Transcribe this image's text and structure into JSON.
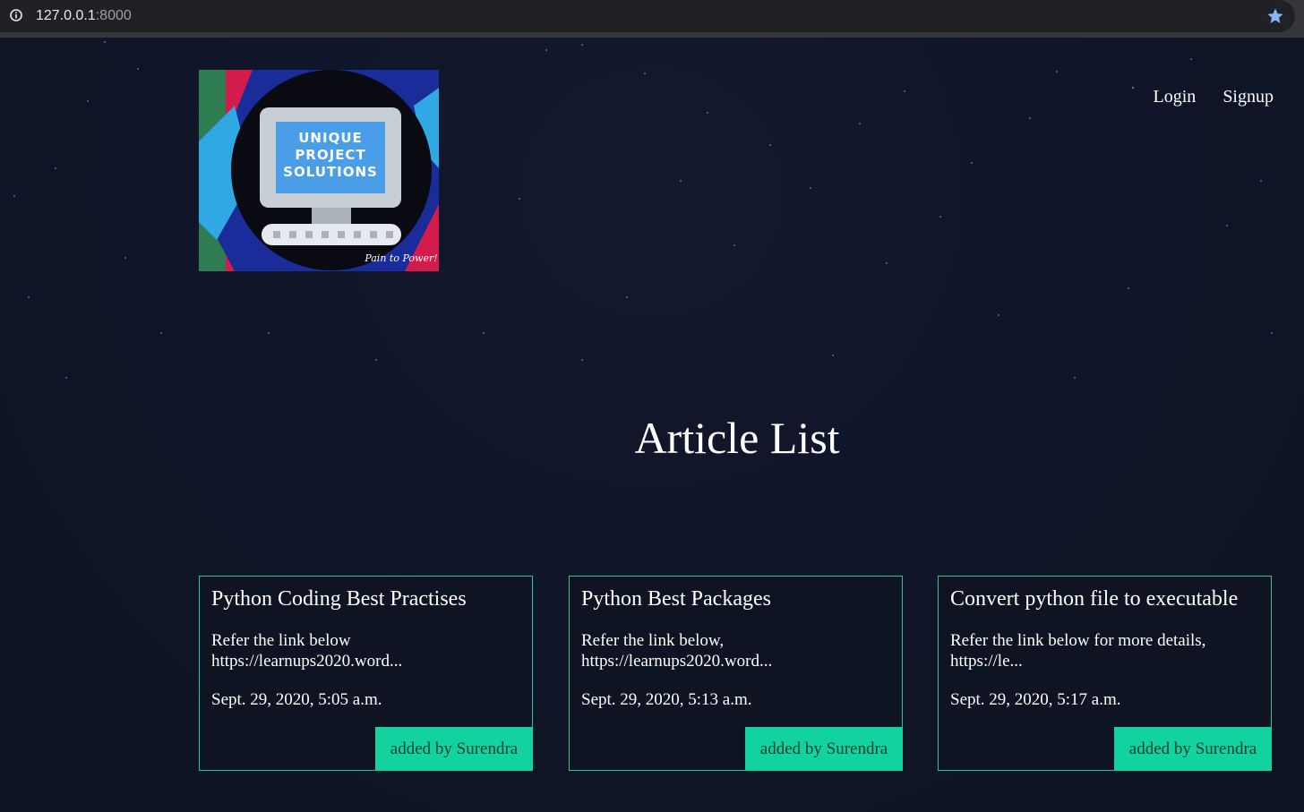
{
  "browser": {
    "url_host": "127.0.0.1",
    "url_port": ":8000"
  },
  "logo": {
    "line1": "UNIQUE",
    "line2": "PROJECT",
    "line3": "SOLUTIONS",
    "tagline": "Pain to Power!"
  },
  "nav": {
    "login": "Login",
    "signup": "Signup"
  },
  "page": {
    "heading": "Article List"
  },
  "articles": [
    {
      "title": "Python Coding Best Practises",
      "snippet": "Refer the link below https://learnups2020.word...",
      "date": "Sept. 29, 2020, 5:05 a.m.",
      "author": "added by Surendra"
    },
    {
      "title": "Python Best Packages",
      "snippet": "Refer the link below, https://learnups2020.word...",
      "date": "Sept. 29, 2020, 5:13 a.m.",
      "author": "added by Surendra"
    },
    {
      "title": "Convert python file to executable",
      "snippet": "Refer the link below for more details, https://le...",
      "date": "Sept. 29, 2020, 5:17 a.m.",
      "author": "added by Surendra"
    }
  ],
  "colors": {
    "accent": "#12d39d",
    "background": "#101424"
  }
}
